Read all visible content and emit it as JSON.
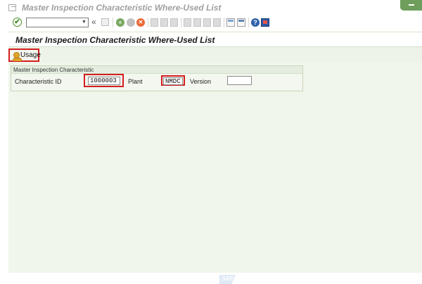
{
  "window": {
    "title": "Master Inspection Characteristic Where-Used List"
  },
  "toolbar": {
    "command_field_value": "",
    "icons": [
      "enter-icon",
      "command-field",
      "collapse-icon",
      "save-icon",
      "back-icon",
      "exit-icon",
      "cancel-icon",
      "print-icon",
      "find-icon",
      "find-next-icon",
      "first-page-icon",
      "previous-page-icon",
      "next-page-icon",
      "last-page-icon",
      "new-session-icon",
      "create-shortcut-icon",
      "help-icon",
      "customize-layout-icon"
    ],
    "collapse_glyph": "«",
    "dropdown_glyph": "▼",
    "enter_glyph": "✔",
    "help_glyph": "?",
    "back_glyph": "«",
    "cancel_glyph": "✕"
  },
  "screen": {
    "title": "Master Inspection Characteristic Where-Used List"
  },
  "app_toolbar": {
    "usage_label": "Usage",
    "usage_icon": "person-icon"
  },
  "group": {
    "title": "Master Inspection Characteristic",
    "characteristic_id_label": "Characteristic ID",
    "characteristic_id_value": "1000003",
    "plant_label": "Plant",
    "plant_value": "NMDC",
    "version_label": "Version",
    "version_value": ""
  },
  "footer": {
    "logo_text": "SAP"
  },
  "colors": {
    "accent_green": "#6f9e5c",
    "panel_background": "#f1f6ec",
    "highlight_red": "#d41e1e",
    "title_text_gray": "#a0a0a0"
  }
}
